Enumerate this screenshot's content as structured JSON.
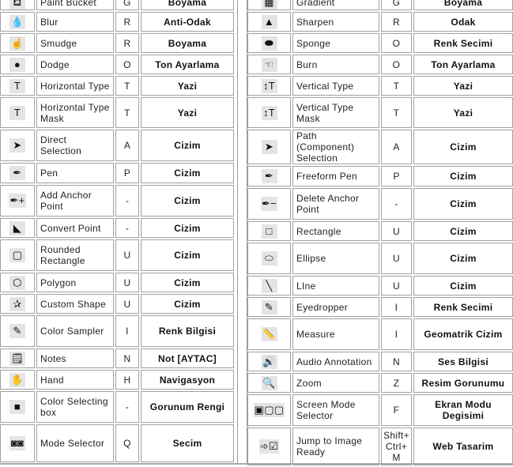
{
  "left": [
    {
      "icon": "paint-bucket-icon",
      "glyph": "⛾",
      "name": "Paint Bucket",
      "key": "G",
      "category": "Boyama",
      "h": 19
    },
    {
      "icon": "blur-icon",
      "glyph": "💧",
      "name": "Blur",
      "key": "R",
      "category": "Anti-Odak",
      "h": 25
    },
    {
      "icon": "smudge-icon",
      "glyph": "☝",
      "name": "Smudge",
      "key": "R",
      "category": "Boyama",
      "h": 25
    },
    {
      "icon": "dodge-icon",
      "glyph": "●",
      "name": "Dodge",
      "key": "O",
      "category": "Ton Ayarlama",
      "h": 25
    },
    {
      "icon": "horizontal-type-icon",
      "glyph": "T",
      "name": "Horizontal Type",
      "key": "T",
      "category": "Yazi",
      "h": 25
    },
    {
      "icon": "horizontal-type-mask-icon",
      "glyph": "T",
      "name": "Horizontal Type Mask",
      "key": "T",
      "category": "Yazi",
      "h": 39
    },
    {
      "icon": "direct-selection-icon",
      "glyph": "➤",
      "name": "Direct Selection",
      "key": "A",
      "category": "Cizim",
      "h": 40
    },
    {
      "icon": "pen-icon",
      "glyph": "✒",
      "name": "Pen",
      "key": "P",
      "category": "Cizim",
      "h": 26
    },
    {
      "icon": "add-anchor-point-icon",
      "glyph": "✒+",
      "name": "Add Anchor Point",
      "key": "-",
      "category": "Cizim",
      "h": 40
    },
    {
      "icon": "convert-point-icon",
      "glyph": "◣",
      "name": "Convert Point",
      "key": "-",
      "category": "Cizim",
      "h": 25
    },
    {
      "icon": "rounded-rectangle-icon",
      "glyph": "▢",
      "name": "Rounded Rectangle",
      "key": "U",
      "category": "Cizim",
      "h": 40
    },
    {
      "icon": "polygon-icon",
      "glyph": "⬡",
      "name": "Polygon",
      "key": "U",
      "category": "Cizim",
      "h": 25
    },
    {
      "icon": "custom-shape-icon",
      "glyph": "✰",
      "name": "Custom Shape",
      "key": "U",
      "category": "Cizim",
      "h": 25
    },
    {
      "icon": "color-sampler-icon",
      "glyph": "✎",
      "name": "Color Sampler",
      "key": "I",
      "category": "Renk Bilgisi",
      "h": 40
    },
    {
      "icon": "notes-icon",
      "glyph": "🗒",
      "name": "Notes",
      "key": "N",
      "category": "Not [AYTAC]",
      "h": 25
    },
    {
      "icon": "hand-icon",
      "glyph": "✋",
      "name": "Hand",
      "key": "H",
      "category": "Navigasyon",
      "h": 25
    },
    {
      "icon": "color-selecting-box-icon",
      "glyph": "■",
      "name": "Color Selecting box",
      "key": "-",
      "category": "Gorunum Rengi",
      "h": 40
    },
    {
      "icon": "mode-selector-icon",
      "glyph": "◙◙",
      "name": "Mode Selector",
      "key": "Q",
      "category": "Secim",
      "h": 48
    }
  ],
  "right": [
    {
      "icon": "gradient-icon",
      "glyph": "▦",
      "name": "Gradient",
      "key": "G",
      "category": "Boyama",
      "h": 19
    },
    {
      "icon": "sharpen-icon",
      "glyph": "▲",
      "name": "Sharpen",
      "key": "R",
      "category": "Odak",
      "h": 25
    },
    {
      "icon": "sponge-icon",
      "glyph": "⬬",
      "name": "Sponge",
      "key": "O",
      "category": "Renk Secimi",
      "h": 25
    },
    {
      "icon": "burn-icon",
      "glyph": "☜",
      "name": "Burn",
      "key": "O",
      "category": "Ton Ayarlama",
      "h": 25
    },
    {
      "icon": "vertical-type-icon",
      "glyph": "↕T",
      "name": "Vertical Type",
      "key": "T",
      "category": "Yazi",
      "h": 25
    },
    {
      "icon": "vertical-type-mask-icon",
      "glyph": "↕T",
      "name": "Vertical Type Mask",
      "key": "T",
      "category": "Yazi",
      "h": 39
    },
    {
      "icon": "path-selection-icon",
      "glyph": "➤",
      "name": "Path (Component) Selection",
      "key": "A",
      "category": "Cizim",
      "h": 40
    },
    {
      "icon": "freeform-pen-icon",
      "glyph": "✒",
      "name": "Freeform Pen",
      "key": "P",
      "category": "Cizim",
      "h": 26
    },
    {
      "icon": "delete-anchor-point-icon",
      "glyph": "✒−",
      "name": "Delete Anchor Point",
      "key": "-",
      "category": "Cizim",
      "h": 40
    },
    {
      "icon": "rectangle-icon",
      "glyph": "□",
      "name": "Rectangle",
      "key": "U",
      "category": "Cizim",
      "h": 25
    },
    {
      "icon": "ellipse-icon",
      "glyph": "⬭",
      "name": "Ellipse",
      "key": "U",
      "category": "Cizim",
      "h": 40
    },
    {
      "icon": "line-icon",
      "glyph": "╲",
      "name": "LIne",
      "key": "U",
      "category": "Cizim",
      "h": 25
    },
    {
      "icon": "eyedropper-icon",
      "glyph": "✎",
      "name": "Eyedropper",
      "key": "I",
      "category": "Renk Secimi",
      "h": 25
    },
    {
      "icon": "measure-icon",
      "glyph": "📏",
      "name": "Measure",
      "key": "I",
      "category": "Geomatrik Cizim",
      "h": 40
    },
    {
      "icon": "audio-annotation-icon",
      "glyph": "🔊",
      "name": "Audio Annotation",
      "key": "N",
      "category": "Ses Bilgisi",
      "h": 25
    },
    {
      "icon": "zoom-icon",
      "glyph": "🔍",
      "name": "Zoom",
      "key": "Z",
      "category": "Resim Gorunumu",
      "h": 25
    },
    {
      "icon": "screen-mode-selector-icon",
      "glyph": "▣▢▢",
      "name": "Screen Mode Selector",
      "key": "F",
      "category": "Ekran Modu Degisimi",
      "h": 40
    },
    {
      "icon": "jump-to-image-ready-icon",
      "glyph": "➾☑",
      "name": "Jump to Image Ready",
      "key": "Shift+ Ctrl+ M",
      "category": "Web Tasarim",
      "h": 48
    }
  ]
}
